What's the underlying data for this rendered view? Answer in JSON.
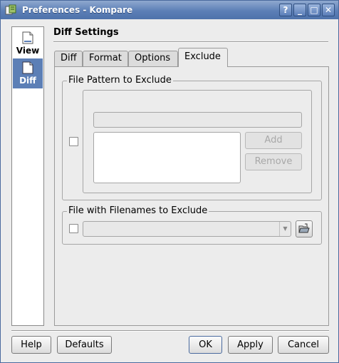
{
  "window": {
    "title": "Preferences - Kompare",
    "help_glyph": "?",
    "minimize_glyph": "_",
    "maximize_glyph": "□",
    "close_glyph": "✕"
  },
  "sidebar": {
    "items": [
      {
        "label": "View",
        "icon": "page-icon",
        "selected": false
      },
      {
        "label": "Diff",
        "icon": "page-icon",
        "selected": true
      }
    ]
  },
  "page": {
    "title": "Diff Settings"
  },
  "tabs": [
    {
      "label": "Diff",
      "mnemonic": "f",
      "active": false
    },
    {
      "label": "Format",
      "mnemonic": "F",
      "active": false
    },
    {
      "label": "Options",
      "mnemonic": "O",
      "active": false
    },
    {
      "label": "Exclude",
      "mnemonic": "E",
      "active": true
    }
  ],
  "exclude": {
    "pattern_group": {
      "title": "File Pattern to Exclude",
      "checked": false,
      "pattern_value": "",
      "add_label": "Add",
      "remove_label": "Remove"
    },
    "file_group": {
      "title": "File with Filenames to Exclude",
      "checked": false,
      "file_value": ""
    }
  },
  "buttons": {
    "help": "Help",
    "defaults": "Defaults",
    "ok": "OK",
    "apply": "Apply",
    "cancel": "Cancel"
  },
  "colors": {
    "titlebar": "#5c7fb6",
    "selection": "#5c7fb6",
    "window_bg": "#ececec"
  }
}
